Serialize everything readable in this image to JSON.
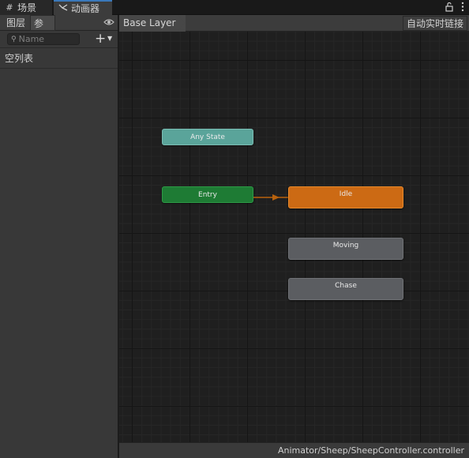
{
  "tabs": [
    {
      "label": "场景",
      "icon": "grid-icon",
      "active": false
    },
    {
      "label": "动画器",
      "icon": "animator-icon",
      "active": true
    }
  ],
  "window_tools": {
    "lock_icon": "lock-icon",
    "menu_icon": "more-vertical-icon"
  },
  "left_panel": {
    "subtabs": {
      "layers": "图层",
      "parameters": "参数"
    },
    "search": {
      "placeholder": "Name",
      "value": ""
    },
    "empty_list_label": "空列表"
  },
  "breadcrumb": {
    "layer": "Base Layer"
  },
  "live_link_label": "自动实时链接",
  "nodes": {
    "any_state": "Any State",
    "entry": "Entry",
    "idle": "Idle",
    "moving": "Moving",
    "chase": "Chase"
  },
  "status_path": "Animator/Sheep/SheepController.controller",
  "colors": {
    "any_state": "#5aa49a",
    "entry": "#1e7b34",
    "default_state": "#cc6a14",
    "state": "#5b5d61",
    "transition": "#b8620d",
    "tab_accent": "#3a79bb"
  }
}
